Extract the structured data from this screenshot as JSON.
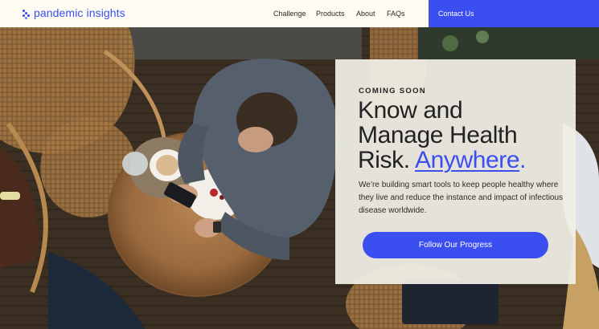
{
  "header": {
    "logo_text": "pandemic insights",
    "nav": [
      "Challenge",
      "Products",
      "About",
      "FAQs"
    ],
    "contact_label": "Contact Us"
  },
  "hero": {
    "eyebrow": "COMING SOON",
    "headline_line1": "Know and",
    "headline_line2": "Manage Health",
    "headline_line3_prefix": "Risk. ",
    "headline_accent": "Anywhere",
    "headline_suffix": ".",
    "description": "We’re building smart tools to keep people healthy where they live and reduce the instance and impact of infectious disease worldwide.",
    "cta_label": "Follow Our Progress"
  },
  "colors": {
    "accent": "#3b4ef0",
    "header_bg": "#fdfbf2",
    "card_bg": "#f0eee4"
  },
  "icons": [
    "logo-dots-icon"
  ]
}
